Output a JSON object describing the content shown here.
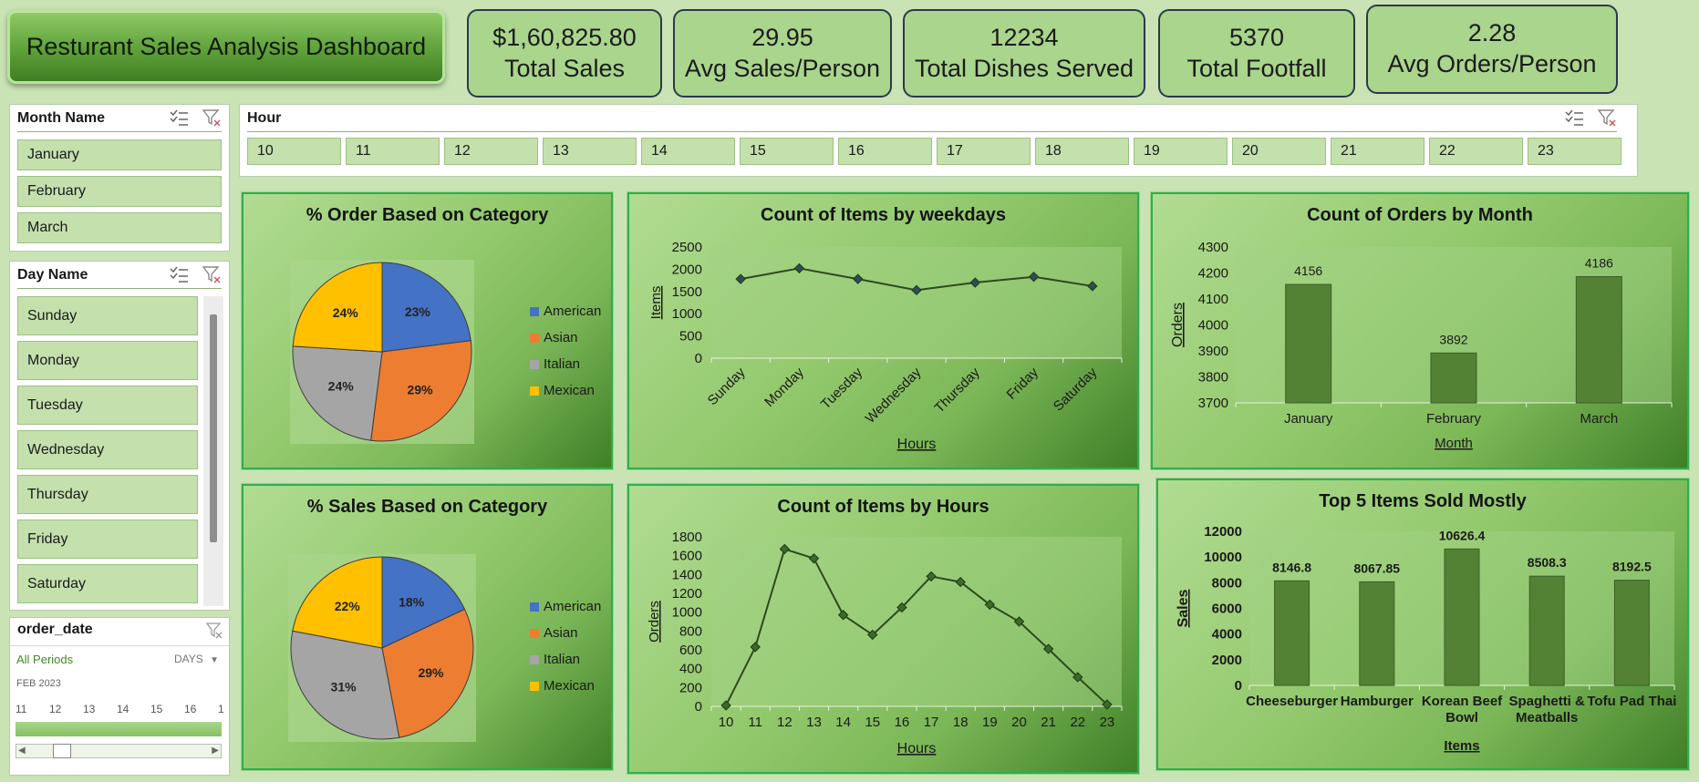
{
  "title": "Resturant Sales Analysis Dashboard",
  "kpis": [
    {
      "value": "$1,60,825.80",
      "label": "Total Sales"
    },
    {
      "value": "29.95",
      "label": "Avg Sales/Person"
    },
    {
      "value": "12234",
      "label": "Total Dishes Served"
    },
    {
      "value": "5370",
      "label": "Total Footfall"
    },
    {
      "value": "2.28",
      "label": "Avg Orders/Person"
    }
  ],
  "month_slicer": {
    "title": "Month Name",
    "items": [
      "January",
      "February",
      "March"
    ]
  },
  "day_slicer": {
    "title": "Day Name",
    "items": [
      "Sunday",
      "Monday",
      "Tuesday",
      "Wednesday",
      "Thursday",
      "Friday",
      "Saturday"
    ]
  },
  "hour_slicer": {
    "title": "Hour",
    "items": [
      "10",
      "11",
      "12",
      "13",
      "14",
      "15",
      "16",
      "17",
      "18",
      "19",
      "20",
      "21",
      "22",
      "23"
    ]
  },
  "timeline": {
    "title": "order_date",
    "period": "All Periods",
    "level": "DAYS",
    "month": "FEB 2023",
    "days": [
      "11",
      "12",
      "13",
      "14",
      "15",
      "16",
      "1"
    ]
  },
  "colors": {
    "american": "#4472c4",
    "asian": "#ed7d31",
    "italian": "#a5a5a5",
    "mexican": "#ffc000",
    "bar": "#548235",
    "line": "#2d4a1e"
  },
  "chart_data": [
    {
      "type": "pie",
      "title": "% Order Based on Category",
      "categories": [
        "American",
        "Asian",
        "Italian",
        "Mexican"
      ],
      "values": [
        23,
        29,
        24,
        24
      ],
      "labels": [
        "23%",
        "29%",
        "24%",
        "24%"
      ],
      "legend": "right"
    },
    {
      "type": "line",
      "title": "Count of Items by weekdays",
      "categories": [
        "Sunday",
        "Monday",
        "Tuesday",
        "Wednesday",
        "Thursday",
        "Friday",
        "Saturday"
      ],
      "values": [
        1780,
        2020,
        1780,
        1530,
        1700,
        1830,
        1620
      ],
      "xlabel": "Hours",
      "ylabel": "Items",
      "ylim": [
        0,
        2500
      ],
      "yticks": [
        "0",
        "500",
        "1000",
        "1500",
        "2000",
        "2500"
      ]
    },
    {
      "type": "bar",
      "title": "Count of Orders by Month",
      "categories": [
        "January",
        "February",
        "March"
      ],
      "values": [
        4156,
        3892,
        4186
      ],
      "xlabel": "Month",
      "ylabel": "Orders",
      "ylim": [
        3700,
        4300
      ],
      "yticks": [
        "3700",
        "3800",
        "3900",
        "4000",
        "4100",
        "4200",
        "4300"
      ]
    },
    {
      "type": "pie",
      "title": "% Sales Based on Category",
      "categories": [
        "American",
        "Asian",
        "Italian",
        "Mexican"
      ],
      "values": [
        18,
        29,
        31,
        22
      ],
      "labels": [
        "18%",
        "29%",
        "31%",
        "22%"
      ],
      "legend": "right"
    },
    {
      "type": "line",
      "title": "Count of Items by Hours",
      "categories": [
        "10",
        "11",
        "12",
        "13",
        "14",
        "15",
        "16",
        "17",
        "18",
        "19",
        "20",
        "21",
        "22",
        "23"
      ],
      "values": [
        10,
        630,
        1670,
        1570,
        970,
        760,
        1050,
        1380,
        1320,
        1080,
        900,
        610,
        310,
        20
      ],
      "xlabel": "Hours",
      "ylabel": "Orders",
      "ylim": [
        0,
        1800
      ],
      "yticks": [
        "0",
        "200",
        "400",
        "600",
        "800",
        "1000",
        "1200",
        "1400",
        "1600",
        "1800"
      ]
    },
    {
      "type": "bar",
      "title": "Top 5 Items Sold Mostly",
      "categories": [
        "Cheeseburger",
        "Hamburger",
        "Korean Beef Bowl",
        "Spaghetti & Meatballs",
        "Tofu Pad Thai"
      ],
      "category_lines": [
        [
          "Cheeseburger"
        ],
        [
          "Hamburger"
        ],
        [
          "Korean Beef",
          "Bowl"
        ],
        [
          "Spaghetti &",
          "Meatballs"
        ],
        [
          "Tofu Pad Thai"
        ]
      ],
      "values": [
        8146.8,
        8067.85,
        10626.4,
        8508.3,
        8192.5
      ],
      "value_labels": [
        "8146.8",
        "8067.85",
        "10626.4",
        "8508.3",
        "8192.5"
      ],
      "xlabel": "Items",
      "ylabel": "Sales",
      "ylim": [
        0,
        12000
      ],
      "yticks": [
        "0",
        "2000",
        "4000",
        "6000",
        "8000",
        "10000",
        "12000"
      ]
    }
  ]
}
